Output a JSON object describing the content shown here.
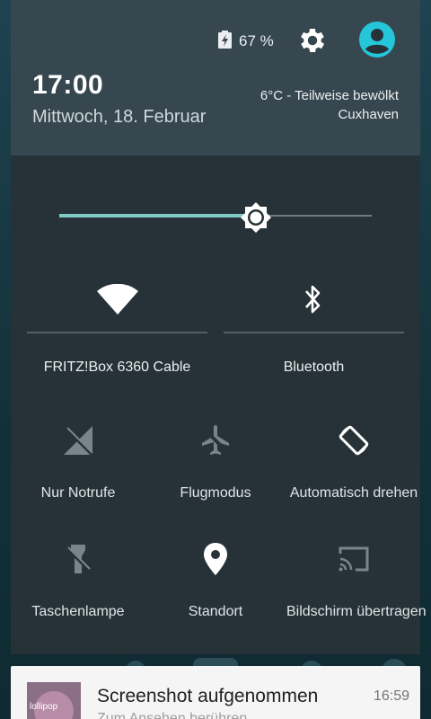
{
  "status": {
    "battery_text": "67 %"
  },
  "header": {
    "time": "17:00",
    "date": "Mittwoch, 18. Februar",
    "weather_line1": "6°C - Teilweise bewölkt",
    "weather_line2": "Cuxhaven"
  },
  "brightness": {
    "level": 0.63
  },
  "tiles_top": [
    {
      "label": "FRITZ!Box 6360 Cable",
      "icon": "wifi-icon"
    },
    {
      "label": "Bluetooth",
      "icon": "bluetooth-icon"
    }
  ],
  "tiles": [
    {
      "label": "Nur Notrufe",
      "icon": "signal-off-icon"
    },
    {
      "label": "Flugmodus",
      "icon": "airplane-icon"
    },
    {
      "label": "Automatisch drehen",
      "icon": "rotate-icon"
    },
    {
      "label": "Taschenlampe",
      "icon": "flashlight-off-icon"
    },
    {
      "label": "Standort",
      "icon": "location-icon"
    },
    {
      "label": "Bildschirm übertragen",
      "icon": "cast-icon"
    }
  ],
  "notification": {
    "title": "Screenshot aufgenommen",
    "time": "16:59",
    "subtitle": "Zum Ansehen berühren",
    "thumb_text": "lollipop"
  },
  "colors": {
    "accent": "#80cbc4",
    "panel": "#263238",
    "header": "#37474f"
  }
}
